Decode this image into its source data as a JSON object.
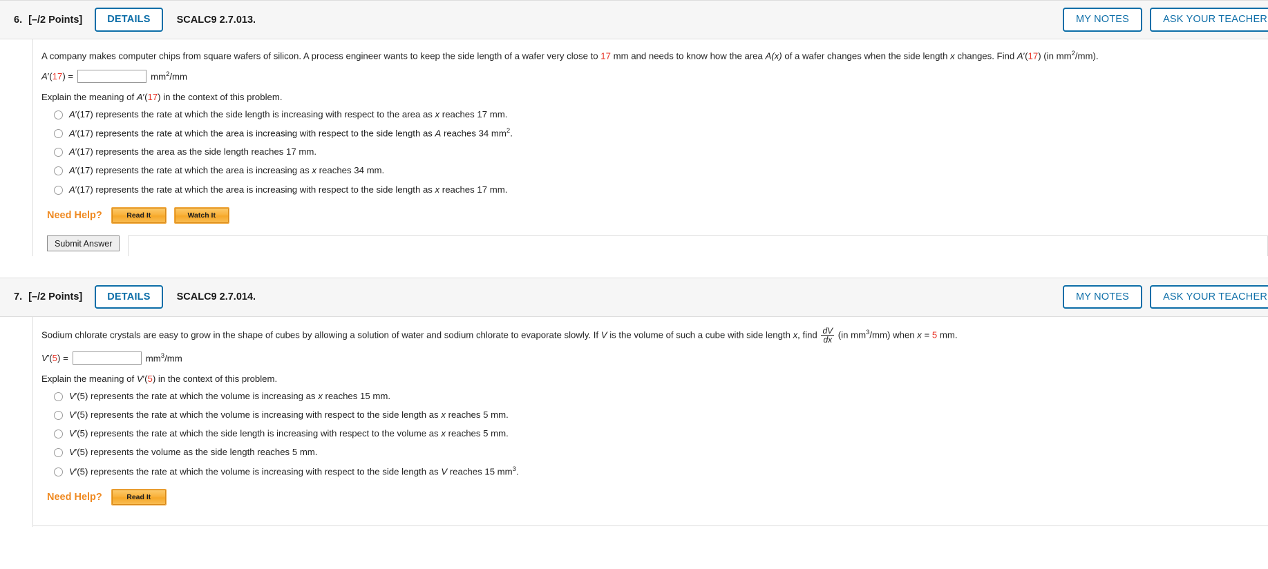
{
  "questions": [
    {
      "number": "6.",
      "points": "[–/2 Points]",
      "details_label": "DETAILS",
      "code": "SCALC9 2.7.013.",
      "my_notes_label": "MY NOTES",
      "ask_teacher_label": "ASK YOUR TEACHER",
      "prompt": {
        "p1": "A company makes computer chips from square wafers of silicon. A process engineer wants to keep the side length of a wafer very close to ",
        "value1": "17",
        "p2": " mm and needs to know how the area ",
        "fn": "A(x)",
        "p3": " of a wafer changes when the side length ",
        "varx": "x",
        "p4": " changes. Find ",
        "fn2": "A",
        "prime": "′(",
        "value2": "17",
        "p5": ") (in mm",
        "exp": "2",
        "p6": "/mm)."
      },
      "answer": {
        "label_fn": "A",
        "label_prime": "′(",
        "label_value": "17",
        "label_close": ") =",
        "input_value": "",
        "input_placeholder": "",
        "unit_pre": "mm",
        "unit_exp": "2",
        "unit_post": "/mm"
      },
      "explain": {
        "pre": "Explain the meaning of ",
        "fn": "A",
        "prime": "′(",
        "value": "17",
        "post": ") in the context of this problem."
      },
      "options": [
        {
          "fn": "A",
          "prime": "′(17)",
          "text": " represents the rate at which the side length is increasing with respect to the area as ",
          "ital": "x",
          "tail": " reaches 17 mm.",
          "sup": ""
        },
        {
          "fn": "A",
          "prime": "′(17)",
          "text": " represents the rate at which the area is increasing with respect to the side length as ",
          "ital": "A",
          "tail": " reaches 34 mm",
          "sup": "2",
          "tail2": "."
        },
        {
          "fn": "A",
          "prime": "′(17)",
          "text": " represents the area as the side length reaches 17 mm.",
          "ital": "",
          "tail": "",
          "sup": ""
        },
        {
          "fn": "A",
          "prime": "′(17)",
          "text": " represents the rate at which the area is increasing as ",
          "ital": "x",
          "tail": " reaches 34 mm.",
          "sup": ""
        },
        {
          "fn": "A",
          "prime": "′(17)",
          "text": " represents the rate at which the area is increasing with respect to the side length as ",
          "ital": "x",
          "tail": " reaches 17 mm.",
          "sup": ""
        }
      ],
      "need_help_label": "Need Help?",
      "help_buttons": [
        "Read It",
        "Watch It"
      ],
      "submit_label": "Submit Answer"
    },
    {
      "number": "7.",
      "points": "[–/2 Points]",
      "details_label": "DETAILS",
      "code": "SCALC9 2.7.014.",
      "my_notes_label": "MY NOTES",
      "ask_teacher_label": "ASK YOUR TEACHER",
      "prompt": {
        "p1": "Sodium chlorate crystals are easy to grow in the shape of cubes by allowing a solution of water and sodium chlorate to evaporate slowly. If ",
        "v": "V",
        "p2": " is the volume of such a cube with side length ",
        "varx": "x",
        "p3": ", find ",
        "frac_num": "dV",
        "frac_den": "dx",
        "p4": " (in mm",
        "exp": "3",
        "p5": "/mm) when ",
        "varx2": "x",
        "p6": " = ",
        "value": "5",
        "p7": " mm."
      },
      "answer": {
        "label_fn": "V",
        "label_prime": "′(",
        "label_value": "5",
        "label_close": ") =",
        "input_value": "",
        "input_placeholder": "",
        "unit_pre": "mm",
        "unit_exp": "3",
        "unit_post": "/mm"
      },
      "explain": {
        "pre": "Explain the meaning of ",
        "fn": "V",
        "prime": "′(",
        "value": "5",
        "post": ") in the context of this problem."
      },
      "options": [
        {
          "fn": "V",
          "prime": "′(5)",
          "text": " represents the rate at which the volume is increasing as ",
          "ital": "x",
          "tail": " reaches 15 mm.",
          "sup": ""
        },
        {
          "fn": "V",
          "prime": "′(5)",
          "text": " represents the rate at which the volume is increasing with respect to the side length as ",
          "ital": "x",
          "tail": " reaches 5 mm.",
          "sup": ""
        },
        {
          "fn": "V",
          "prime": "′(5)",
          "text": " represents the rate at which the side length is increasing with respect to the volume as ",
          "ital": "x",
          "tail": " reaches 5 mm.",
          "sup": ""
        },
        {
          "fn": "V",
          "prime": "′(5)",
          "text": " represents the volume as the side length reaches 5 mm.",
          "ital": "",
          "tail": "",
          "sup": ""
        },
        {
          "fn": "V",
          "prime": "′(5)",
          "text": " represents the rate at which the volume is increasing with respect to the side length as ",
          "ital": "V",
          "tail": " reaches 15 mm",
          "sup": "3",
          "tail2": "."
        }
      ],
      "need_help_label": "Need Help?",
      "help_buttons": [
        "Read It"
      ]
    }
  ]
}
